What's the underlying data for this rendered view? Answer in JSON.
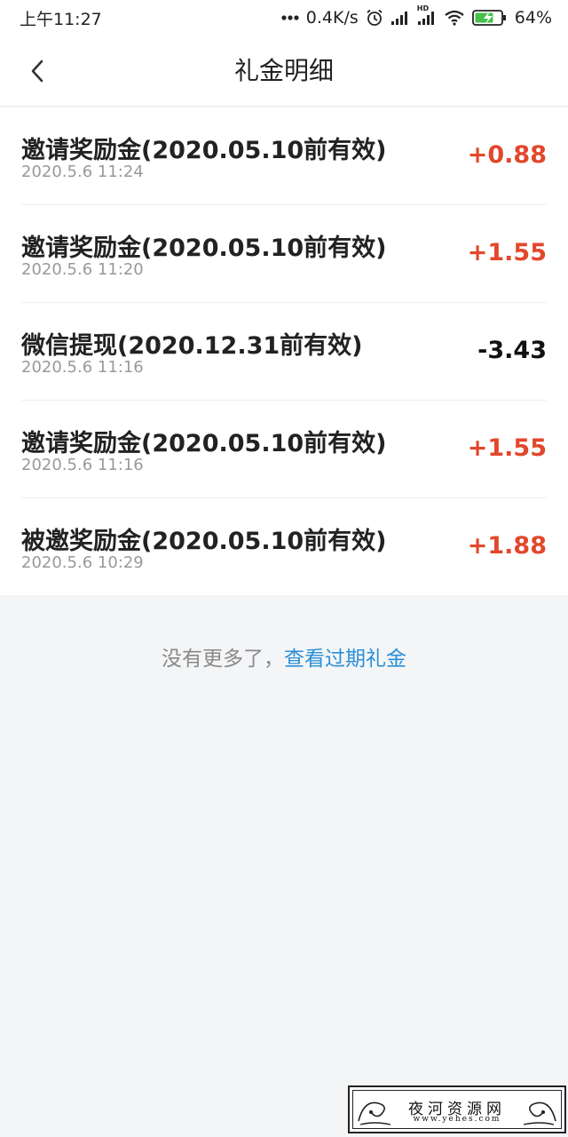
{
  "status_bar": {
    "time": "上午11:27",
    "net_speed": "0.4K/s",
    "network_type": "HD",
    "battery_percent": "64%",
    "icons": [
      "more-dots-icon",
      "alarm-clock-icon",
      "cellular-signal-icon",
      "hd-signal-icon",
      "wifi-icon",
      "battery-charging-icon"
    ]
  },
  "header": {
    "title": "礼金明细",
    "back_icon": "chevron-left-icon"
  },
  "records": [
    {
      "title": "邀请奖励金(2020.05.10前有效)",
      "time": "2020.5.6 11:24",
      "amount": "+0.88",
      "type": "income"
    },
    {
      "title": "邀请奖励金(2020.05.10前有效)",
      "time": "2020.5.6 11:20",
      "amount": "+1.55",
      "type": "income"
    },
    {
      "title": "微信提现(2020.12.31前有效)",
      "time": "2020.5.6 11:16",
      "amount": "-3.43",
      "type": "expense"
    },
    {
      "title": "邀请奖励金(2020.05.10前有效)",
      "time": "2020.5.6 11:16",
      "amount": "+1.55",
      "type": "income"
    },
    {
      "title": "被邀奖励金(2020.05.10前有效)",
      "time": "2020.5.6 10:29",
      "amount": "+1.88",
      "type": "income"
    }
  ],
  "footer": {
    "no_more_text": "没有更多了，",
    "expired_link": "查看过期礼金"
  },
  "watermark": {
    "title": "夜河资源网",
    "url": "www.yehes.com"
  },
  "colors": {
    "income": "#e2472b",
    "expense": "#111111",
    "link": "#2a8fd8",
    "page_background": "#f4f5f7"
  }
}
